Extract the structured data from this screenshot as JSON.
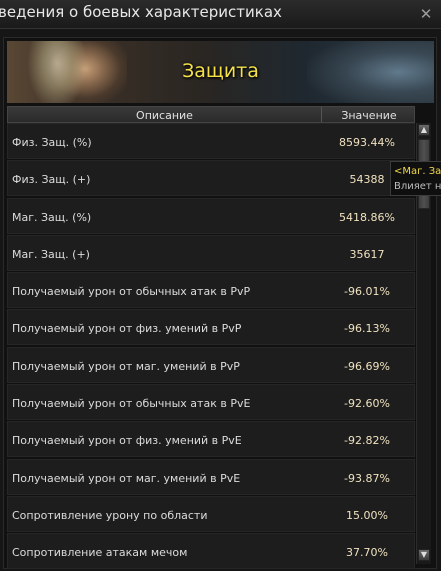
{
  "window": {
    "title": "ведения о боевых характеристиках",
    "close_symbol": "✕"
  },
  "banner": {
    "title": "Защита"
  },
  "table": {
    "columns": [
      "Описание",
      "Значение"
    ],
    "rows": [
      {
        "desc": "Физ. Защ. (%)",
        "value": "8593.44%"
      },
      {
        "desc": "Физ. Защ. (+)",
        "value": "54388"
      },
      {
        "desc": "Маг. Защ. (%)",
        "value": "5418.86%"
      },
      {
        "desc": "Маг. Защ. (+)",
        "value": "35617"
      },
      {
        "desc": "Получаемый урон от обычных атак в PvP",
        "value": "-96.01%"
      },
      {
        "desc": "Получаемый урон от физ. умений в PvP",
        "value": "-96.13%"
      },
      {
        "desc": "Получаемый урон от маг. умений в PvP",
        "value": "-96.69%"
      },
      {
        "desc": "Получаемый урон от обычных атак в PvE",
        "value": "-92.60%"
      },
      {
        "desc": "Получаемый урон от физ. умений в PvE",
        "value": "-92.82%"
      },
      {
        "desc": "Получаемый урон от маг. умений в PvE",
        "value": "-93.87%"
      },
      {
        "desc": "Сопротивление урону по области",
        "value": "15.00%"
      },
      {
        "desc": "Сопротивление атакам мечом",
        "value": "37.70%"
      }
    ]
  },
  "scrollbar": {
    "up_symbol": "▲",
    "down_symbol": "▼"
  },
  "tooltip": {
    "line1": "<Маг. Защ",
    "line2": "Влияет на"
  }
}
